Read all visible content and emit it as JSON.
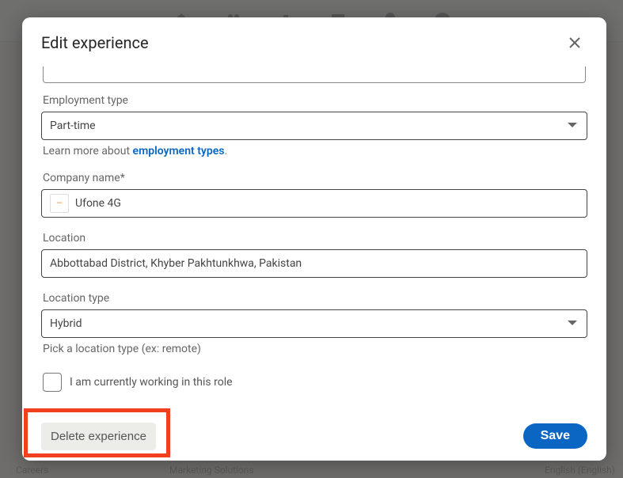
{
  "modal": {
    "title": "Edit experience",
    "employment_type_label": "Employment type",
    "employment_type_value": "Part-time",
    "learn_more_prefix": "Learn more about ",
    "learn_more_link": "employment types",
    "company_label": "Company name*",
    "company_value": "Ufone 4G",
    "location_label": "Location",
    "location_value": "Abbottabad District, Khyber Pakhtunkhwa, Pakistan",
    "location_type_label": "Location type",
    "location_type_value": "Hybrid",
    "location_type_helper": "Pick a location type (ex: remote)",
    "current_role_label": "I am currently working in this role",
    "delete_label": "Delete experience",
    "save_label": "Save"
  },
  "bg": {
    "careers": "Careers",
    "marketing": "Marketing Solutions",
    "lang": "English (English)"
  }
}
